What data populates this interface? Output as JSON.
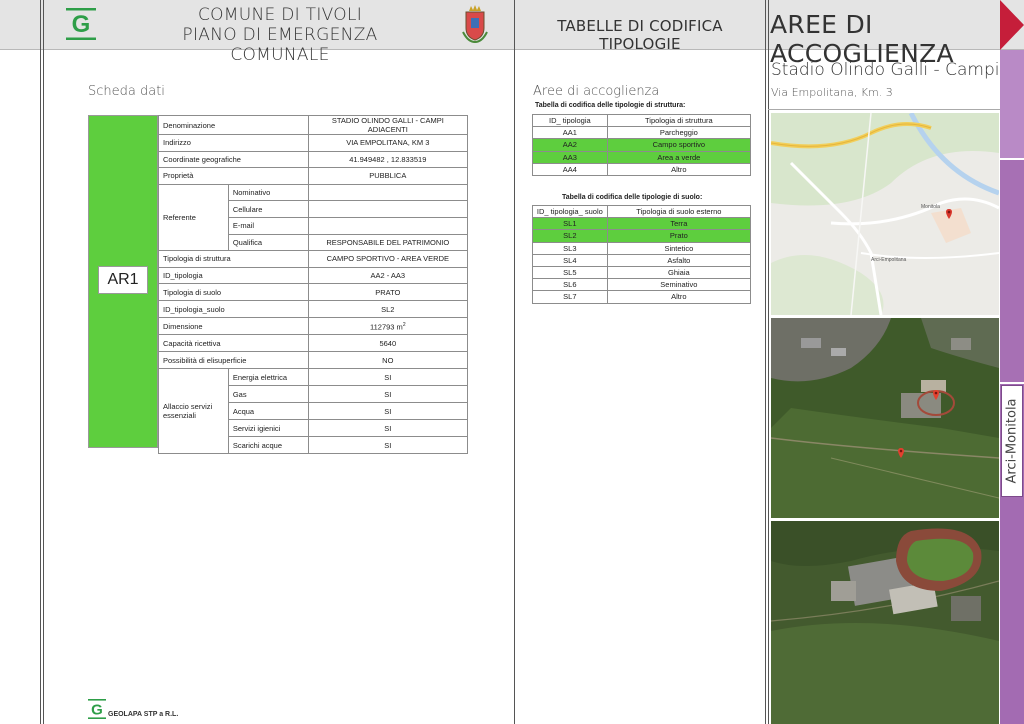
{
  "header": {
    "comune_line1": "COMUNE DI TIVOLI",
    "comune_line2": "PIANO DI EMERGENZA COMUNALE",
    "tabelle": "TABELLE DI CODIFICA TIPOLOGIE",
    "aree": "AREE DI ACCOGLIENZA",
    "logo_letter": "G"
  },
  "colors": {
    "accent_green": "#5ece3e",
    "purple": "#a36bb2",
    "red": "#c51e3a",
    "logo_green": "#2e9e48"
  },
  "vertical_label": "Arci-Monitola",
  "scheda": {
    "title": "Scheda dati",
    "code": "AR1",
    "denominazione_label": "Denominazione",
    "denominazione_value": "STADIO OLINDO GALLI - CAMPI ADIACENTI",
    "indirizzo_label": "Indirizzo",
    "indirizzo_value": "VIA EMPOLITANA, KM 3",
    "coordinate_label": "Coordinate geografiche",
    "coordinate_value": "41.949482 , 12.833519",
    "proprieta_label": "Proprietà",
    "proprieta_value": "PUBBLICA",
    "referente_label": "Referente",
    "nominativo_label": "Nominativo",
    "nominativo_value": "",
    "cellulare_label": "Cellulare",
    "cellulare_value": "",
    "email_label": "E-mail",
    "email_value": "",
    "qualifica_label": "Qualifica",
    "qualifica_value": "RESPONSABILE DEL PATRIMONIO",
    "tipologia_struttura_label": "Tipologia di struttura",
    "tipologia_struttura_value": "CAMPO SPORTIVO - AREA VERDE",
    "id_tipologia_label": "ID_tipologia",
    "id_tipologia_value": "AA2 - AA3",
    "tipologia_suolo_label": "Tipologia di suolo",
    "tipologia_suolo_value": "PRATO",
    "id_tipologia_suolo_label": "ID_tipologia_suolo",
    "id_tipologia_suolo_value": "SL2",
    "dimensione_label": "Dimensione",
    "dimensione_value": "112793 m",
    "dimensione_unit_sup": "2",
    "capacita_label": "Capacità ricettiva",
    "capacita_value": "5640",
    "elisuperficie_label": "Possibilità di elisuperficie",
    "elisuperficie_value": "NO",
    "allaccio_label": "Allaccio servizi essenziali",
    "energia_label": "Energia elettrica",
    "energia_value": "SI",
    "gas_label": "Gas",
    "gas_value": "SI",
    "acqua_label": "Acqua",
    "acqua_value": "SI",
    "servizi_label": "Servizi igienici",
    "servizi_value": "SI",
    "scarichi_label": "Scarichi acque",
    "scarichi_value": "SI"
  },
  "aree": {
    "title": "Aree di accoglienza",
    "struttura_caption": "Tabella di codifica delle tipologie di struttura:",
    "struttura_head_id": "ID_ tipologia",
    "struttura_head_name": "Tipologia di struttura",
    "struttura_rows": [
      {
        "id": "AA1",
        "name": "Parcheggio",
        "hl": false
      },
      {
        "id": "AA2",
        "name": "Campo sportivo",
        "hl": true
      },
      {
        "id": "AA3",
        "name": "Area a verde",
        "hl": true
      },
      {
        "id": "AA4",
        "name": "Altro",
        "hl": false
      }
    ],
    "suolo_caption": "Tabella di codifica delle tipologie di suolo:",
    "suolo_head_id": "ID_ tipologia_ suolo",
    "suolo_head_name": "Tipologia di suolo esterno",
    "suolo_rows": [
      {
        "id": "SL1",
        "name": "Terra",
        "hl": true
      },
      {
        "id": "SL2",
        "name": "Prato",
        "hl": true
      },
      {
        "id": "SL3",
        "name": "Sintetico",
        "hl": false
      },
      {
        "id": "SL4",
        "name": "Asfalto",
        "hl": false
      },
      {
        "id": "SL5",
        "name": "Ghiaia",
        "hl": false
      },
      {
        "id": "SL6",
        "name": "Seminativo",
        "hl": false
      },
      {
        "id": "SL7",
        "name": "Altro",
        "hl": false
      }
    ]
  },
  "stadio": {
    "name": "Stadio Olindo Galli - Campi",
    "address": "Via Empolitana, Km. 3",
    "map_label_1": "Monitola",
    "map_label_2": "Arci-Empolitana"
  },
  "footer": {
    "logo_letter": "G",
    "company": "GEOLAPA STP  a R.L."
  }
}
